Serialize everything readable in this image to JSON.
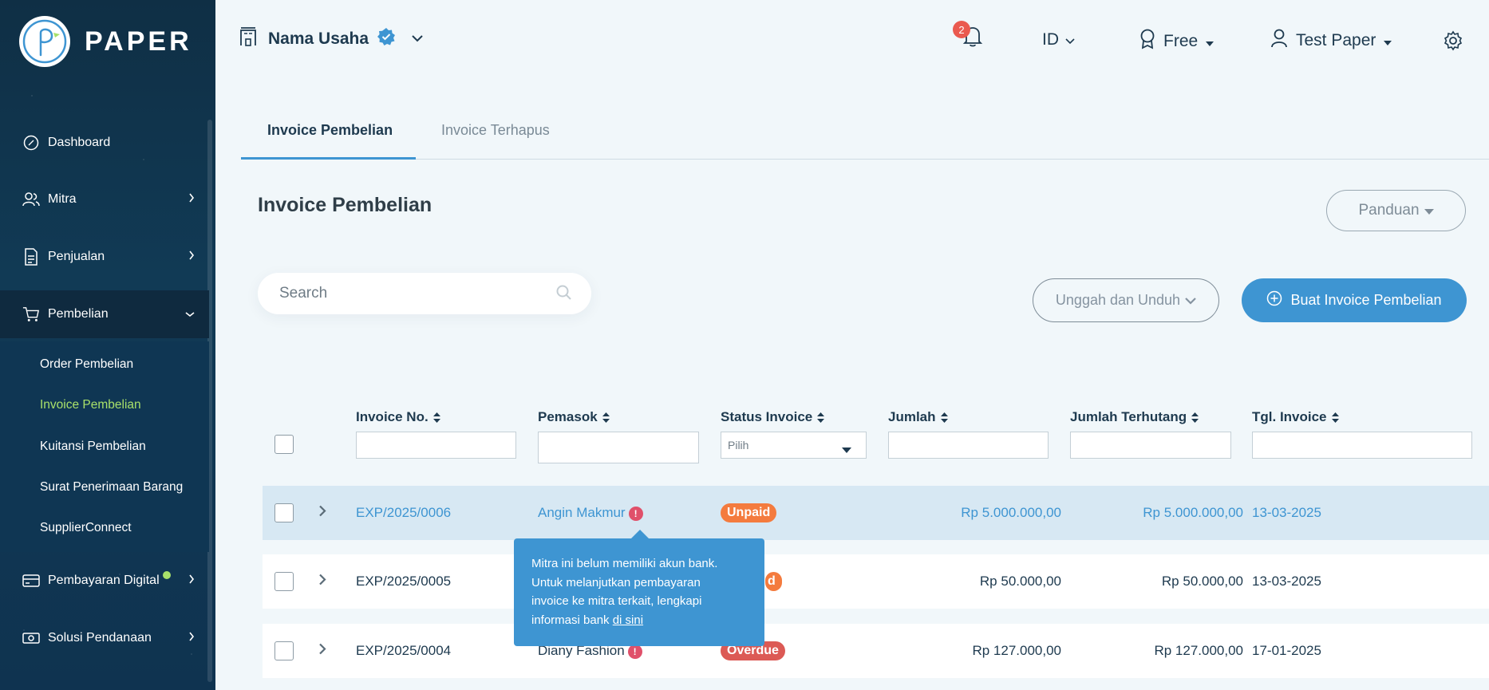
{
  "app": {
    "brand": "PAPER"
  },
  "colors": {
    "primary": "#3e95d2",
    "sidebar": "#0f2f45",
    "unpaid": "#f47b3e",
    "overdue": "#dc5a55",
    "active_nav": "#a8e06a"
  },
  "sidebar": {
    "items": [
      {
        "label": "Dashboard",
        "icon": "compass-icon"
      },
      {
        "label": "Mitra",
        "icon": "users-icon"
      },
      {
        "label": "Penjualan",
        "icon": "document-icon"
      },
      {
        "label": "Pembelian",
        "icon": "cart-icon"
      },
      {
        "label": "Pembayaran Digital",
        "icon": "card-icon"
      },
      {
        "label": "Solusi Pendanaan",
        "icon": "money-icon"
      }
    ],
    "sub_items": [
      {
        "label": "Order Pembelian"
      },
      {
        "label": "Invoice Pembelian"
      },
      {
        "label": "Kuitansi Pembelian"
      },
      {
        "label": "Surat Penerimaan Barang"
      },
      {
        "label": "SupplierConnect"
      }
    ]
  },
  "header": {
    "business_name": "Nama Usaha",
    "notification_count": "2",
    "language": "ID",
    "plan": "Free",
    "user": "Test Paper"
  },
  "tabs": [
    {
      "label": "Invoice Pembelian"
    },
    {
      "label": "Invoice Terhapus"
    }
  ],
  "main": {
    "title": "Invoice Pembelian",
    "guide_button": "Panduan",
    "search_placeholder": "Search",
    "upload_download_button": "Unggah dan Unduh",
    "create_button": "Buat Invoice Pembelian"
  },
  "table": {
    "columns": [
      "Invoice No.",
      "Pemasok",
      "Status Invoice",
      "Jumlah",
      "Jumlah Terhutang",
      "Tgl. Invoice"
    ],
    "status_filter_placeholder": "Pilih",
    "rows": [
      {
        "invoice_no": "EXP/2025/0006",
        "supplier": "Angin Makmur",
        "status": "Unpaid",
        "amount": "Rp 5.000.000,00",
        "outstanding": "Rp 5.000.000,00",
        "date": "13-03-2025"
      },
      {
        "invoice_no": "EXP/2025/0005",
        "supplier": "",
        "status": "Unpaid",
        "status_visible": "d",
        "amount": "Rp 50.000,00",
        "outstanding": "Rp 50.000,00",
        "date": "13-03-2025"
      },
      {
        "invoice_no": "EXP/2025/0004",
        "supplier": "Diany Fashion",
        "status": "Overdue",
        "amount": "Rp 127.000,00",
        "outstanding": "Rp 127.000,00",
        "date": "17-01-2025"
      }
    ]
  },
  "tooltip": {
    "line1": "Mitra ini belum memiliki akun bank.",
    "line2": "Untuk melanjutkan pembayaran",
    "line3": "invoice ke mitra terkait, lengkapi",
    "line4_prefix": "informasi bank ",
    "link": "di sini"
  }
}
